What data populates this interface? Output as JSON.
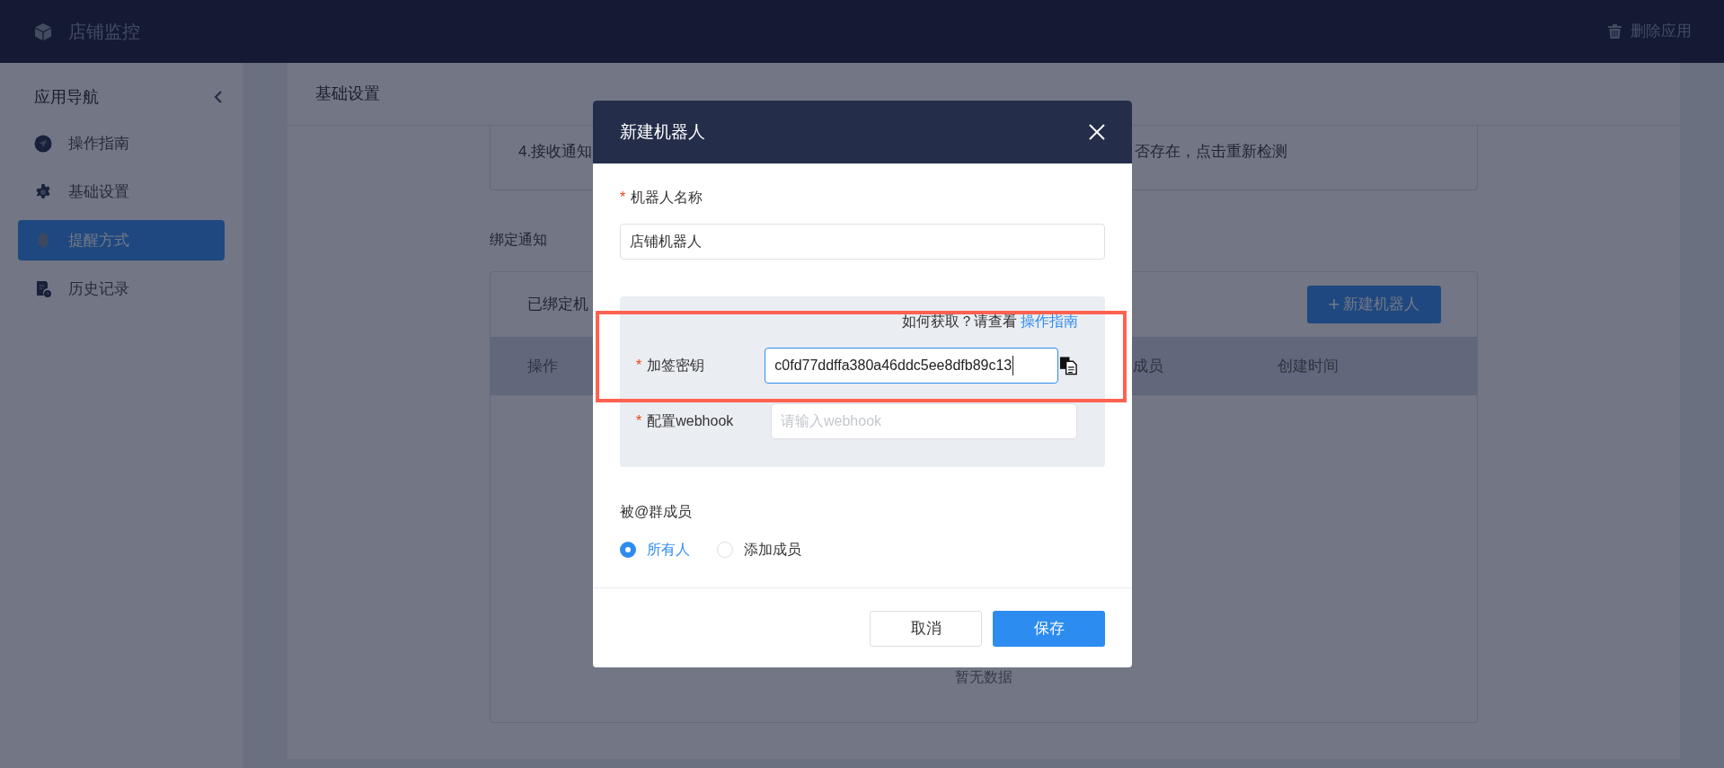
{
  "app_bar": {
    "title": "店铺监控",
    "action": "删除应用"
  },
  "sidebar": {
    "title": "应用导航",
    "items": [
      {
        "label": "操作指南",
        "kind": "guide",
        "selected": false
      },
      {
        "label": "基础设置",
        "kind": "settings",
        "selected": false
      },
      {
        "label": "提醒方式",
        "kind": "alert",
        "selected": true
      },
      {
        "label": "历史记录",
        "kind": "history",
        "selected": false
      }
    ]
  },
  "main": {
    "title": "基础设置",
    "notice_left": "4.接收通知",
    "notice_right": "否存在，点击重新检测",
    "section_title": "绑定通知",
    "table": {
      "title": "已绑定机",
      "new_button": "新建机器人",
      "new_button_icon": "+",
      "columns": [
        "操作",
        "成员",
        "创建时间"
      ],
      "empty_text": "暂无数据"
    }
  },
  "dialog": {
    "title": "新建机器人",
    "name_field": {
      "mark": "*",
      "label": "机器人名称",
      "value": "店铺机器人"
    },
    "hint": {
      "text": "如何获取？请查看 ",
      "link": "操作指南"
    },
    "secret_field": {
      "mark": "*",
      "label": "加签密钥",
      "value": "c0fd77ddffa380a46ddc5ee8dfb89c13",
      "focused": true
    },
    "webhook_field": {
      "mark": "*",
      "label": "配置webhook",
      "placeholder": "请输入webhook",
      "focused": false
    },
    "mention": {
      "label": "被@群成员",
      "options": [
        {
          "label": "所有人",
          "selected": true
        },
        {
          "label": "添加成员",
          "selected": false
        }
      ]
    },
    "buttons": [
      {
        "label": "取消",
        "kind": "secondary"
      },
      {
        "label": "保存",
        "kind": "primary"
      }
    ]
  }
}
